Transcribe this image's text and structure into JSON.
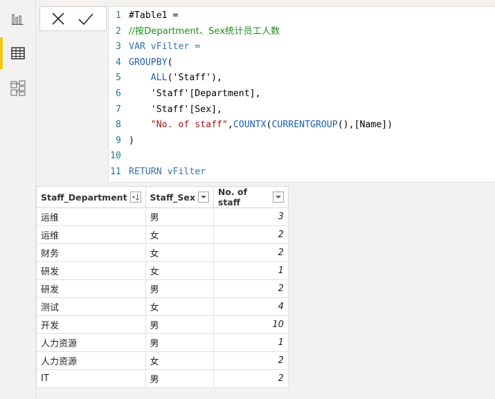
{
  "rail": {
    "items": [
      {
        "icon": "report-view-icon"
      },
      {
        "icon": "data-view-icon",
        "active": true
      },
      {
        "icon": "model-view-icon"
      }
    ]
  },
  "formula_bar": {
    "cancel_icon": "close-icon",
    "commit_icon": "check-icon",
    "lines": [
      {
        "n": "1",
        "parts": [
          {
            "t": "#Table1 =",
            "c": "tx"
          }
        ]
      },
      {
        "n": "2",
        "parts": [
          {
            "t": "//按Department、Sex统计员工人数",
            "c": "cm"
          }
        ]
      },
      {
        "n": "3",
        "parts": [
          {
            "t": "VAR vFilter =",
            "c": "kw"
          }
        ]
      },
      {
        "n": "4",
        "parts": [
          {
            "t": "GROUPBY",
            "c": "fn"
          },
          {
            "t": "(",
            "c": "tx"
          }
        ]
      },
      {
        "n": "5",
        "parts": [
          {
            "t": "    ALL",
            "c": "fn"
          },
          {
            "t": "('Staff'),",
            "c": "tx"
          }
        ]
      },
      {
        "n": "6",
        "parts": [
          {
            "t": "    'Staff'[Department],",
            "c": "tx"
          }
        ]
      },
      {
        "n": "7",
        "parts": [
          {
            "t": "    'Staff'[Sex],",
            "c": "tx"
          }
        ]
      },
      {
        "n": "8",
        "parts": [
          {
            "t": "    \"No. of staff\"",
            "c": "str"
          },
          {
            "t": ",",
            "c": "tx"
          },
          {
            "t": "COUNTX",
            "c": "fn"
          },
          {
            "t": "(",
            "c": "tx"
          },
          {
            "t": "CURRENTGROUP",
            "c": "fn"
          },
          {
            "t": "(),[Name])",
            "c": "tx"
          }
        ]
      },
      {
        "n": "9",
        "parts": [
          {
            "t": ")",
            "c": "tx"
          }
        ]
      },
      {
        "n": "10",
        "parts": []
      },
      {
        "n": "11",
        "parts": [
          {
            "t": "RETURN vFilter",
            "c": "kw"
          }
        ]
      }
    ]
  },
  "table": {
    "columns": [
      {
        "label": "Staff_Department",
        "icon": "sort-descending-icon"
      },
      {
        "label": "Staff_Sex",
        "icon": "chevron-down-icon"
      },
      {
        "label": "No. of staff",
        "icon": "chevron-down-icon"
      }
    ],
    "rows": [
      [
        "运维",
        "男",
        "3"
      ],
      [
        "运维",
        "女",
        "2"
      ],
      [
        "财务",
        "女",
        "2"
      ],
      [
        "研发",
        "女",
        "1"
      ],
      [
        "研发",
        "男",
        "2"
      ],
      [
        "测试",
        "女",
        "4"
      ],
      [
        "开发",
        "男",
        "10"
      ],
      [
        "人力资源",
        "男",
        "1"
      ],
      [
        "人力资源",
        "女",
        "2"
      ],
      [
        "IT",
        "男",
        "2"
      ]
    ]
  }
}
